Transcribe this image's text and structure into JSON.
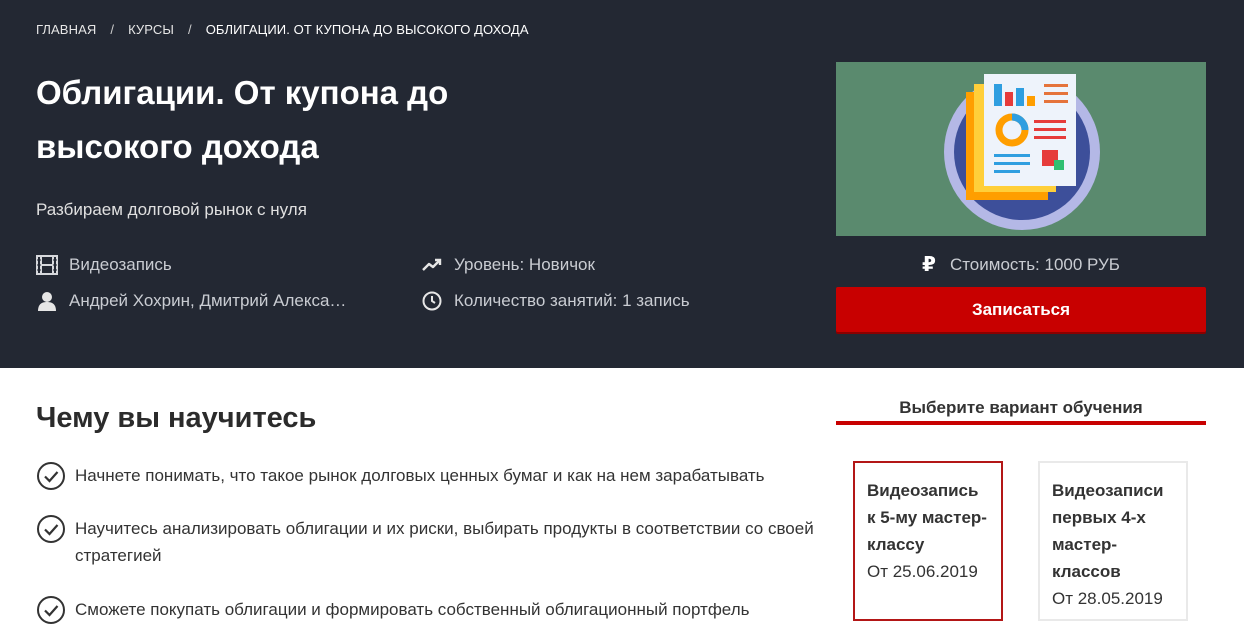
{
  "breadcrumb": {
    "home": "ГЛАВНАЯ",
    "courses": "КУРСЫ",
    "current": "ОБЛИГАЦИИ. ОТ КУПОНА ДО ВЫСОКОГО ДОХОДА",
    "separator": "/"
  },
  "course": {
    "title_line1": "Облигации. От купона до",
    "title_line2": "высокого дохода",
    "subtitle": "Разбираем долговой рынок с нуля",
    "format": "Видеозапись",
    "level": "Уровень: Новичок",
    "authors": "Андрей Хохрин, Дмитрий Алекса…",
    "lessons": "Количество занятий: 1 запись",
    "price_symbol": "₽",
    "price": "Стоимость: 1000 РУБ",
    "enroll_label": "Записаться"
  },
  "learn": {
    "title": "Чему вы научитесь",
    "items": [
      "Начнете понимать, что такое рынок долговых ценных бумаг и как на нем зарабатывать",
      "Научитесь анализировать облигации и их риски, выбирать продукты в соответствии со своей стратегией",
      "Сможете покупать облигации и формировать собственный облигационный портфель"
    ]
  },
  "variants": {
    "title": "Выберите вариант обучения",
    "options": [
      {
        "name": "Видеозапись к 5-му мастер-классу",
        "date": "От 25.06.2019",
        "selected": true
      },
      {
        "name": "Видеозаписи первых 4-х мастер-классов",
        "date": "От 28.05.2019",
        "selected": false
      }
    ]
  },
  "colors": {
    "hero_bg": "#232833",
    "accent_red": "#c80000",
    "cover_bg": "#5a8a6e"
  },
  "icons": [
    "film-icon",
    "trend-up-icon",
    "user-icon",
    "clock-icon",
    "ruble-icon",
    "check-circle-icon"
  ]
}
